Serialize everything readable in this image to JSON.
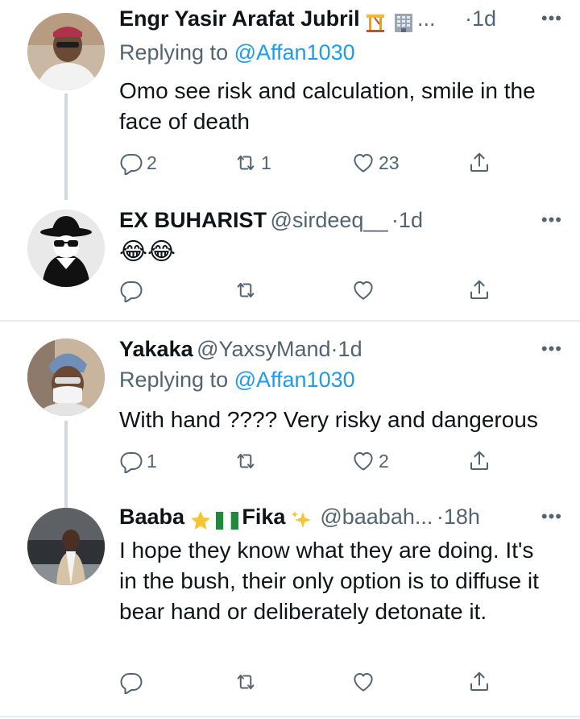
{
  "tweets": [
    {
      "name": "Engr Yasir Arafat Jubril",
      "handle": "",
      "name_suffix": "...",
      "dot": "·",
      "time": "1d",
      "replying_label": "Replying to",
      "replying_to": "@Affan1030",
      "text": "Omo see risk and calculation, smile in the face of death",
      "reply_count": "2",
      "retweet_count": "1",
      "like_count": "23"
    },
    {
      "name": "EX BUHARIST",
      "handle": "@sirdeeq__",
      "dot": "·",
      "time": "1d",
      "text": "😂😂",
      "reply_count": "",
      "retweet_count": "",
      "like_count": ""
    },
    {
      "name": "Yakaka",
      "handle": "@YaxsyMand",
      "dot": "·",
      "time": "1d",
      "replying_label": "Replying to",
      "replying_to": "@Affan1030",
      "text": "With hand ???? Very risky and dangerous",
      "reply_count": "1",
      "retweet_count": "",
      "like_count": "2"
    },
    {
      "name_part1": "Baaba",
      "name_part2": "Fika",
      "handle": "@baabah...",
      "dot": "·",
      "time": "18h",
      "text": "I hope they know what they are doing. It's in the bush, their only option is to diffuse it bear hand or deliberately detonate it.",
      "reply_count": "",
      "retweet_count": "",
      "like_count": ""
    }
  ],
  "more_glyph": "•••",
  "colors": {
    "accent": "#1d9bf0",
    "muted": "#536471",
    "text": "#0f1419",
    "divider": "#e6ecf0"
  }
}
